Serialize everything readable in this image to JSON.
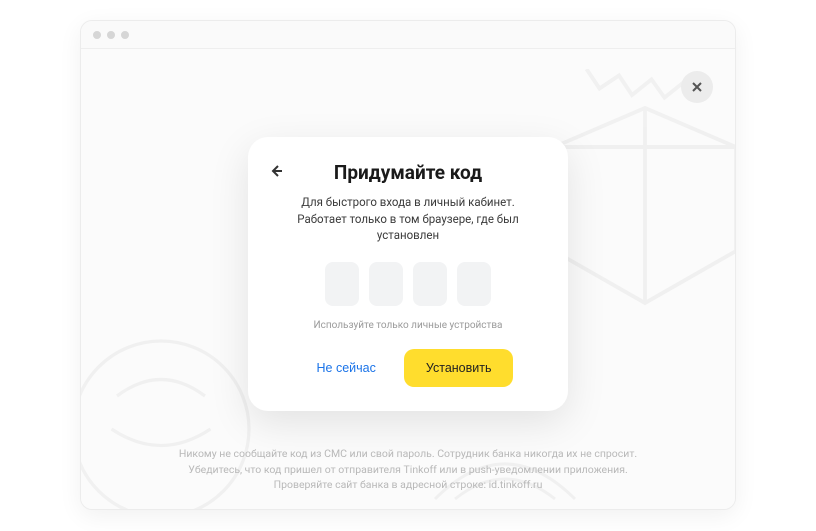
{
  "modal": {
    "title": "Придумайте код",
    "subtitle": "Для быстрого входа в личный кабинет. Работает только в том браузере, где был установлен",
    "hint": "Используйте только личные устройства",
    "secondary_button": "Не сейчас",
    "primary_button": "Установить"
  },
  "footer": {
    "text": "Никому не сообщайте код из СМС или свой пароль. Сотрудник банка никогда их не спросит. Убедитесь, что код пришел от отправителя Tinkoff или в push-уведомлении приложения. Проверяйте сайт банка в адресной строке: id.tinkoff.ru"
  }
}
